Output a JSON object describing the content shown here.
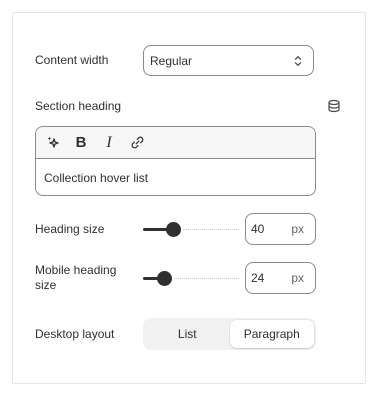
{
  "content_width": {
    "label": "Content width",
    "selected": "Regular",
    "icon": "chevron-up-down-icon"
  },
  "section_heading": {
    "label": "Section heading",
    "icon": "database-icon",
    "toolbar": {
      "ai_icon": "sparkle-icon",
      "bold": "B",
      "italic": "I",
      "link_icon": "link-icon"
    },
    "value": "Collection hover list"
  },
  "heading_size": {
    "label": "Heading size",
    "value": "40",
    "unit": "px",
    "slider_fraction": 0.31
  },
  "mobile_heading_size": {
    "label_line1": "Mobile heading",
    "label_line2": "size",
    "value": "24",
    "unit": "px",
    "slider_fraction": 0.22
  },
  "desktop_layout": {
    "label": "Desktop layout",
    "options": [
      "List",
      "Paragraph"
    ],
    "selected": "Paragraph"
  },
  "colors": {
    "text": "#303030",
    "border": "#8a8a8a",
    "segmented_bg": "#f1f1f1"
  }
}
